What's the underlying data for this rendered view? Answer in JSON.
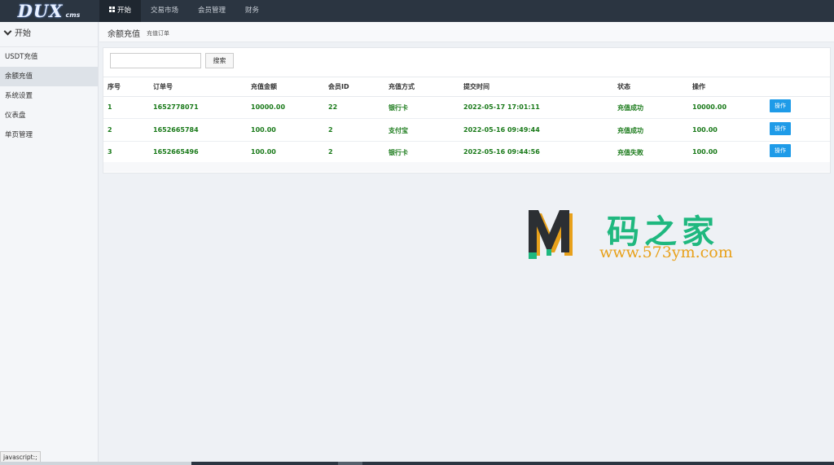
{
  "app": {
    "logo_main": "DUX",
    "logo_sub": "cms"
  },
  "topnav": [
    {
      "label": "开始",
      "active": true
    },
    {
      "label": "交易市场"
    },
    {
      "label": "会员管理"
    },
    {
      "label": "财务"
    }
  ],
  "sidebar": {
    "header": "开始",
    "items": [
      {
        "label": "USDT充值"
      },
      {
        "label": "余额充值",
        "active": true
      },
      {
        "label": "系统设置"
      },
      {
        "label": "仪表盘"
      },
      {
        "label": "单页管理"
      }
    ]
  },
  "breadcrumb": {
    "title": "余额充值",
    "sub": "充值订单"
  },
  "search": {
    "value": "",
    "button": "搜索"
  },
  "table": {
    "headers": [
      "序号",
      "订单号",
      "充值金额",
      "会员ID",
      "充值方式",
      "提交时间",
      "状态",
      "操作"
    ],
    "rows": [
      {
        "cells": [
          "1",
          "1652778071",
          "10000.00",
          "22",
          "银行卡",
          "2022-05-17 17:01:11",
          "充值成功",
          "10000.00"
        ],
        "action": "操作"
      },
      {
        "cells": [
          "2",
          "1652665784",
          "100.00",
          "2",
          "支付宝",
          "2022-05-16 09:49:44",
          "充值成功",
          "100.00"
        ],
        "action": "操作"
      },
      {
        "cells": [
          "3",
          "1652665496",
          "100.00",
          "2",
          "银行卡",
          "2022-05-16 09:44:56",
          "充值失败",
          "100.00"
        ],
        "action": "操作"
      }
    ]
  },
  "watermark": {
    "cn": "码之家",
    "url": "www.573ym.com"
  },
  "status_tip": "javascript:;",
  "colors": {
    "topbar": "#2b3541",
    "green_text": "#1a7a1a",
    "action_button": "#1e9be8",
    "watermark_green": "#1fb87f",
    "watermark_orange": "#e8a11b"
  }
}
